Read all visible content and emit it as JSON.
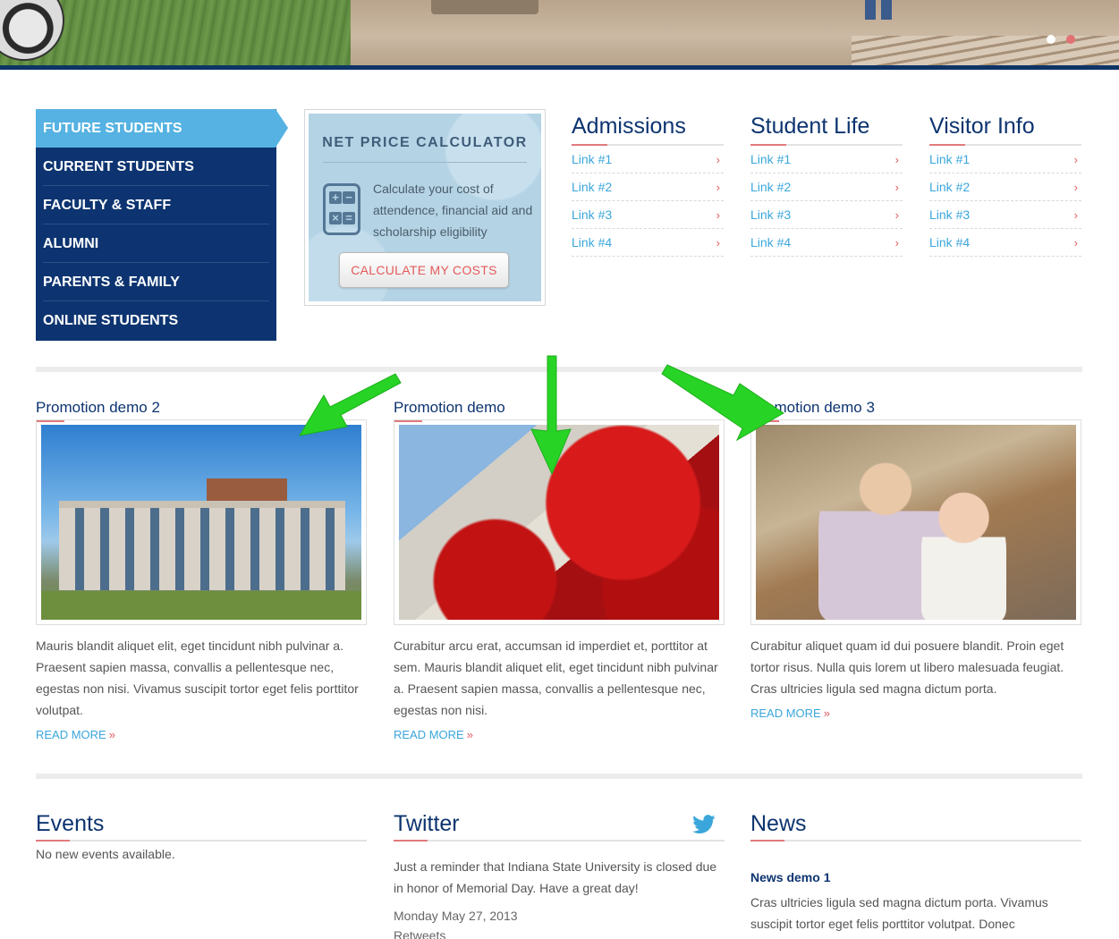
{
  "colors": {
    "navy": "#0d3470",
    "active_blue": "#55b2e2",
    "link_blue": "#3aa6db",
    "accent_red": "#e25b60",
    "arrow_green": "#27d425"
  },
  "audience_nav": {
    "active": "FUTURE STUDENTS",
    "items": [
      "CURRENT STUDENTS",
      "FACULTY & STAFF",
      "ALUMNI",
      "PARENTS & FAMILY",
      "ONLINE STUDENTS"
    ]
  },
  "calculator": {
    "title": "NET PRICE CALCULATOR",
    "description": "Calculate your cost of attendence, financial aid and scholarship eligibility",
    "button": "CALCULATE MY COSTS",
    "icon": "calculator-icon"
  },
  "link_columns": [
    {
      "title": "Admissions",
      "links": [
        "Link #1",
        "Link #2",
        "Link #3",
        "Link #4"
      ]
    },
    {
      "title": "Student Life",
      "links": [
        "Link #1",
        "Link #2",
        "Link #3",
        "Link #4"
      ]
    },
    {
      "title": "Visitor Info",
      "links": [
        "Link #1",
        "Link #2",
        "Link #3",
        "Link #4"
      ]
    }
  ],
  "promotions": [
    {
      "title": "Promotion demo 2",
      "image": "building-photo",
      "text": "Mauris blandit aliquet elit, eget tincidunt nibh pulvinar a. Praesent sapien massa, convallis a pellentesque nec, egestas non nisi. Vivamus suscipit tortor eget felis porttitor volutpat.",
      "more": "READ MORE"
    },
    {
      "title": "Promotion demo",
      "image": "red-leaves-photo",
      "text": "Curabitur arcu erat, accumsan id imperdiet et, porttitor at sem. Mauris blandit aliquet elit, eget tincidunt nibh pulvinar a. Praesent sapien massa, convallis a pellentesque nec, egestas non nisi.",
      "more": "READ MORE"
    },
    {
      "title": "Promotion demo 3",
      "image": "nursery-photo",
      "text": "Curabitur aliquet quam id dui posuere blandit. Proin eget tortor risus. Nulla quis lorem ut libero malesuada feugiat. Cras ultricies ligula sed magna dictum porta.",
      "more": "READ MORE"
    }
  ],
  "events": {
    "title": "Events",
    "text": "No new events available."
  },
  "twitter": {
    "title": "Twitter",
    "icon": "twitter-bird-icon",
    "tweet": "Just a reminder that Indiana State University is closed due in honor of Memorial Day. Have a great day!",
    "date": "Monday May 27, 2013",
    "retweets": "Retweets"
  },
  "news": {
    "title": "News",
    "item_title": "News demo 1",
    "item_text": "Cras ultricies ligula sed magna dictum porta. Vivamus suscipit tortor eget felis porttitor volutpat. Donec"
  }
}
